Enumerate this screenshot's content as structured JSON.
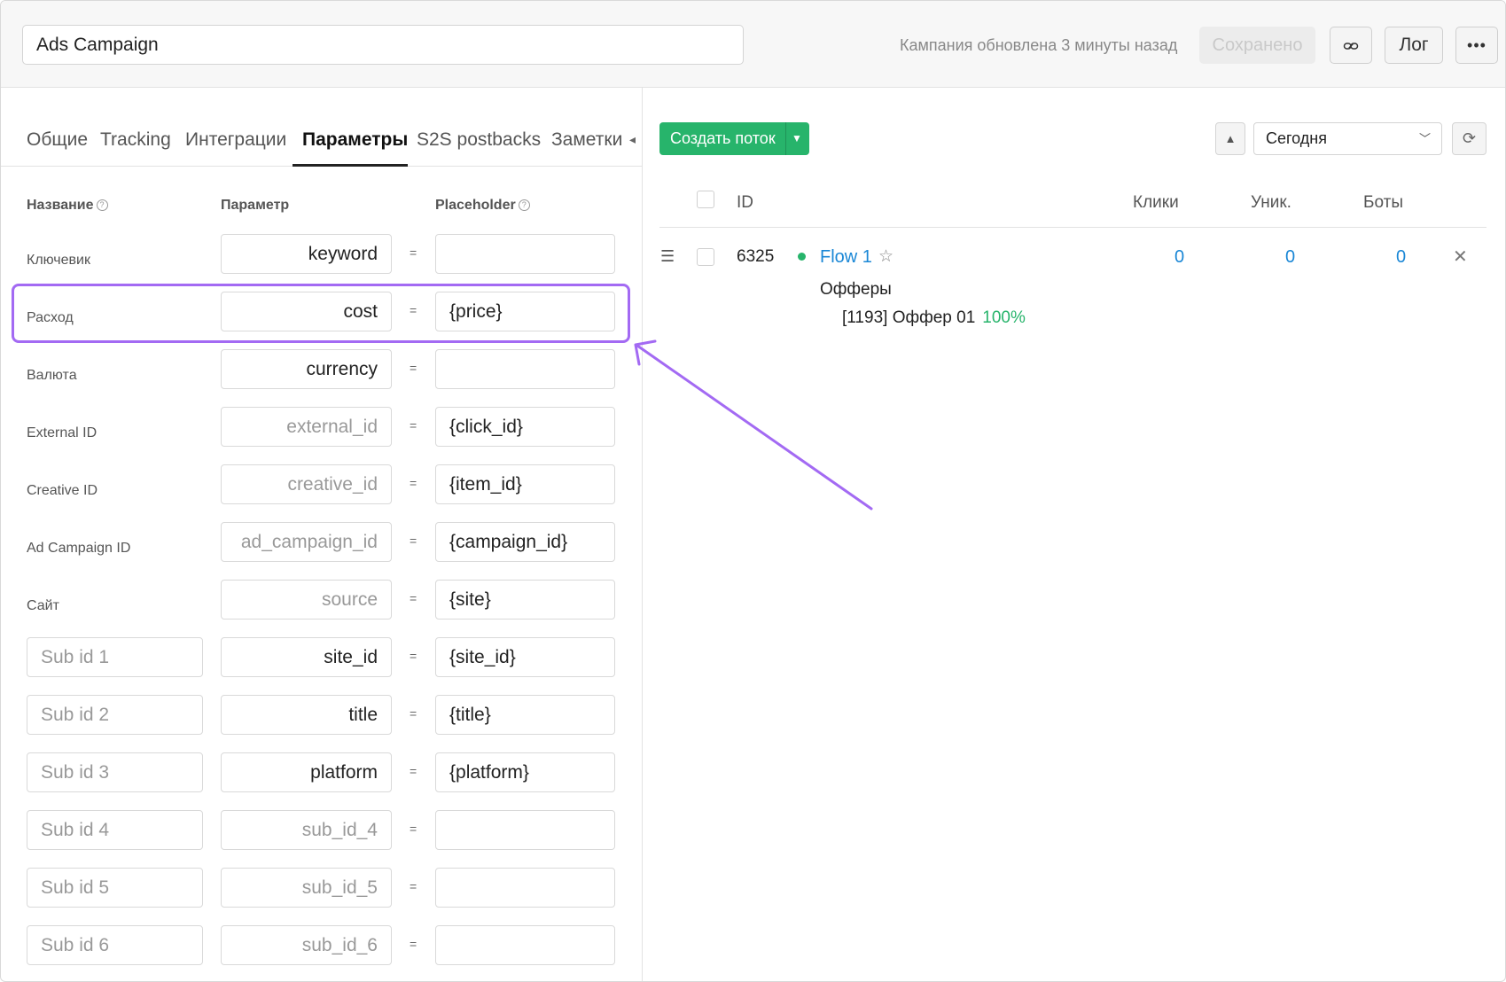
{
  "header": {
    "campaign_name": "Ads Campaign",
    "update_status": "Кампания обновлена 3 минуты назад",
    "saved_label": "Сохранено",
    "log_label": "Лог",
    "more_label": "•••",
    "link_icon": "link-icon"
  },
  "tabs": [
    {
      "label": "Общие"
    },
    {
      "label": "Tracking"
    },
    {
      "label": "Интеграции"
    },
    {
      "label": "Параметры"
    },
    {
      "label": "S2S postbacks"
    },
    {
      "label": "Заметки"
    }
  ],
  "active_tab": "Параметры",
  "params_table": {
    "headers": {
      "name": "Название",
      "param": "Параметр",
      "placeholder": "Placeholder"
    },
    "equals": "=",
    "rows": [
      {
        "label": "Ключевик",
        "param": "keyword",
        "placeholder": ""
      },
      {
        "label": "Расход",
        "param": "cost",
        "placeholder": "{price}"
      },
      {
        "label": "Валюта",
        "param": "currency",
        "placeholder": ""
      },
      {
        "label": "External ID",
        "param": "external_id",
        "placeholder": "{click_id}"
      },
      {
        "label": "Creative ID",
        "param": "creative_id",
        "placeholder": "{item_id}"
      },
      {
        "label": "Ad Campaign ID",
        "param": "ad_campaign_id",
        "placeholder": "{campaign_id}"
      },
      {
        "label": "Сайт",
        "param": "source",
        "placeholder": "{site}"
      }
    ],
    "sub_rows": [
      {
        "name": "Sub id 1",
        "param": "site_id",
        "placeholder": "{site_id}"
      },
      {
        "name": "Sub id 2",
        "param": "title",
        "placeholder": "{title}"
      },
      {
        "name": "Sub id 3",
        "param": "platform",
        "placeholder": "{platform}"
      },
      {
        "name": "Sub id 4",
        "param": "sub_id_4",
        "placeholder": ""
      },
      {
        "name": "Sub id 5",
        "param": "sub_id_5",
        "placeholder": ""
      },
      {
        "name": "Sub id 6",
        "param": "sub_id_6",
        "placeholder": ""
      }
    ]
  },
  "flows": {
    "create_label": "Создать поток",
    "date_range": "Сегодня",
    "headers": {
      "id": "ID",
      "clicks": "Клики",
      "unique": "Уник.",
      "bots": "Боты"
    },
    "rows": [
      {
        "id": "6325",
        "name": "Flow 1",
        "clicks": "0",
        "unique": "0",
        "bots": "0",
        "offers_title": "Офферы",
        "offer": "[1193] Оффер 01",
        "offer_share": "100%"
      }
    ]
  },
  "colors": {
    "accent_green": "#27b46b",
    "link_blue": "#1a87d6",
    "highlight_purple": "#a36af3"
  }
}
